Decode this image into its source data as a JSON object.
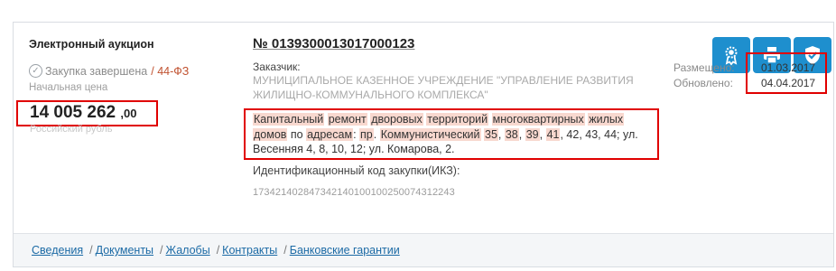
{
  "procurement": {
    "type": "Электронный аукцион",
    "status": "Закупка завершена",
    "law": "44-ФЗ",
    "price_label": "Начальная цена",
    "price_main": "14 005 262",
    "price_cents": ",00",
    "currency": "Российский рубль",
    "number": "№ 0139300013017000123",
    "customer_label": "Заказчик:",
    "customer_name": "МУНИЦИПАЛЬНОЕ КАЗЕННОЕ УЧРЕЖДЕНИЕ \"УПРАВЛЕНИЕ РАЗВИТИЯ ЖИЛИЩНО-КОММУНАЛЬНОГО КОМПЛЕКСА\"",
    "subject_parts": [
      {
        "t": "Капитальный",
        "h": true
      },
      {
        "t": " ",
        "h": false
      },
      {
        "t": "ремонт",
        "h": true
      },
      {
        "t": " ",
        "h": false
      },
      {
        "t": "дворовых",
        "h": true
      },
      {
        "t": " ",
        "h": false
      },
      {
        "t": "территорий",
        "h": true
      },
      {
        "t": " ",
        "h": false
      },
      {
        "t": "многоквартирных",
        "h": true
      },
      {
        "t": " ",
        "h": false
      },
      {
        "t": "жилых",
        "h": true
      },
      {
        "t": " ",
        "h": false
      },
      {
        "t": "домов",
        "h": true
      },
      {
        "t": " по ",
        "h": false
      },
      {
        "t": "адресам",
        "h": true
      },
      {
        "t": ": ",
        "h": false
      },
      {
        "t": "пр",
        "h": true
      },
      {
        "t": ". ",
        "h": false
      },
      {
        "t": "Коммунистический",
        "h": true
      },
      {
        "t": " ",
        "h": false
      },
      {
        "t": "35",
        "h": true
      },
      {
        "t": ", ",
        "h": false
      },
      {
        "t": "38",
        "h": true
      },
      {
        "t": ", ",
        "h": false
      },
      {
        "t": "39",
        "h": true
      },
      {
        "t": ", ",
        "h": false
      },
      {
        "t": "41",
        "h": true
      },
      {
        "t": ", 42, 43, 44; ул. Весенняя 4, 8, 10, 12; ул. Комарова, 2.",
        "h": false
      }
    ],
    "ikz_label": "Идентификационный код закупки(ИКЗ):",
    "ikz_value": "173421402847342140100100250074312243",
    "posted_label": "Размещено:",
    "updated_label": "Обновлено:",
    "posted_date": "01.03.2017",
    "updated_date": "04.04.2017"
  },
  "actions": [
    {
      "name": "certificate-icon"
    },
    {
      "name": "printer-icon"
    },
    {
      "name": "shield-check-icon"
    }
  ],
  "footer_links": [
    "Сведения",
    "Документы",
    "Жалобы",
    "Контракты",
    "Банковские гарантии"
  ],
  "colors": {
    "accent": "#1e8fce",
    "highlight_box": "#e00000",
    "link": "#1b6aa5",
    "law": "#c0512f",
    "mark": "#f8d8cf"
  }
}
